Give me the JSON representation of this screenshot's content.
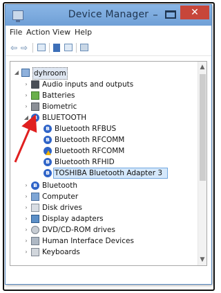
{
  "window": {
    "title": "Device Manager",
    "minimize_glyph": "–",
    "close_glyph": "✕"
  },
  "menu": [
    "File",
    "Action",
    "View",
    "Help"
  ],
  "toolbar": {
    "icons": [
      "back-arrow-icon",
      "forward-arrow-icon",
      "properties-icon",
      "help-icon",
      "show-hidden-icon",
      "scan-hardware-icon"
    ],
    "back_glyph": "⇦",
    "forward_glyph": "⇨"
  },
  "tree": {
    "root": {
      "label": "dyhroom",
      "expander": "◢"
    },
    "categories": [
      {
        "label": "Audio inputs and outputs",
        "expander": "›",
        "icon": "speaker-icon"
      },
      {
        "label": "Batteries",
        "expander": "›",
        "icon": "battery-icon"
      },
      {
        "label": "Biometric",
        "expander": "›",
        "icon": "fingerprint-icon"
      },
      {
        "label": "BLUETOOTH",
        "expander": "◢",
        "icon": "bluetooth-icon"
      },
      {
        "label": "Bluetooth",
        "expander": "›",
        "icon": "bluetooth-icon"
      },
      {
        "label": "Computer",
        "expander": "›",
        "icon": "computer-icon"
      },
      {
        "label": "Disk drives",
        "expander": "›",
        "icon": "disk-drive-icon"
      },
      {
        "label": "Display adapters",
        "expander": "›",
        "icon": "display-adapter-icon"
      },
      {
        "label": "DVD/CD-ROM drives",
        "expander": "›",
        "icon": "dvd-drive-icon"
      },
      {
        "label": "Human Interface Devices",
        "expander": "›",
        "icon": "hid-icon"
      },
      {
        "label": "Keyboards",
        "expander": "›",
        "icon": "keyboard-icon"
      }
    ],
    "bluetooth_children": [
      {
        "label": "Bluetooth RFBUS",
        "warning": false
      },
      {
        "label": "Bluetooth RFCOMM",
        "warning": false
      },
      {
        "label": "Bluetooth RFCOMM",
        "warning": true
      },
      {
        "label": "Bluetooth RFHID",
        "warning": false
      },
      {
        "label": "TOSHIBA Bluetooth Adapter 3",
        "warning": false,
        "selected": true
      }
    ],
    "bt_glyph": "ʙ"
  },
  "scrollbar": {
    "up": "▲",
    "down": "▼"
  },
  "colors": {
    "titlebar": "#7aaae0",
    "close_button": "#c7463a",
    "selection": "#d5e8fb",
    "annotation_arrow": "#e02020"
  }
}
